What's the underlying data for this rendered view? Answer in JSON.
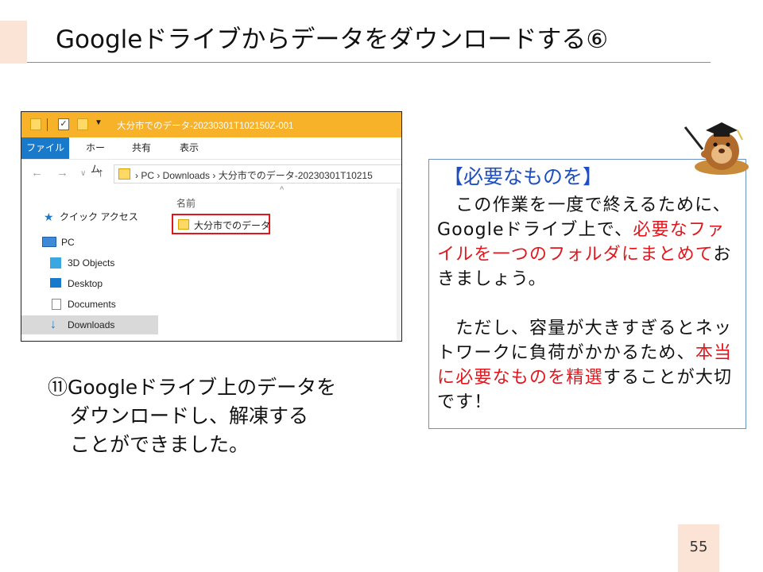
{
  "slide": {
    "title": "Googleドライブからデータをダウンロードする⑥",
    "page_number": "55"
  },
  "explorer": {
    "window_title": "大分市でのデータ-20230301T102150Z-001",
    "ribbon_tabs": {
      "file": "ファイル",
      "home": "ホーム",
      "share": "共有",
      "view": "表示"
    },
    "address_path": "›  PC  ›  Downloads  ›  大分市でのデータ-20230301T10215",
    "nav_pane": {
      "quick_access": "クイック アクセス",
      "pc": "PC",
      "objects_3d": "3D Objects",
      "desktop": "Desktop",
      "documents": "Documents",
      "downloads": "Downloads"
    },
    "column_header": "名前",
    "highlighted_folder": "大分市でのデータ",
    "highlight_color": "#e2171e",
    "titlebar_color": "#f7b22a"
  },
  "caption": {
    "line1": "⑪Googleドライブ上のデータを",
    "line2": "ダウンロードし、解凍する",
    "line3": "ことができました。"
  },
  "advice": {
    "heading": "【必要なものを】",
    "p1_a": "　この作業を一度で終えるために、Googleドライブ上で、",
    "p1_red": "必要なファイルを一つのフォルダにまとめて",
    "p1_b": "おきましょう。",
    "p2_a": "　ただし、容量が大きすぎるとネットワークに負荷がかかるため、",
    "p2_red": "本当に必要なものを精選",
    "p2_b": "することが大切です！"
  },
  "icons": [
    "folder-icon",
    "checkbox-icon",
    "back-arrow-icon",
    "forward-arrow-icon",
    "up-arrow-icon",
    "star-icon",
    "pc-icon",
    "cube-icon",
    "desktop-icon",
    "document-icon",
    "download-icon",
    "mole-mascot-icon"
  ]
}
